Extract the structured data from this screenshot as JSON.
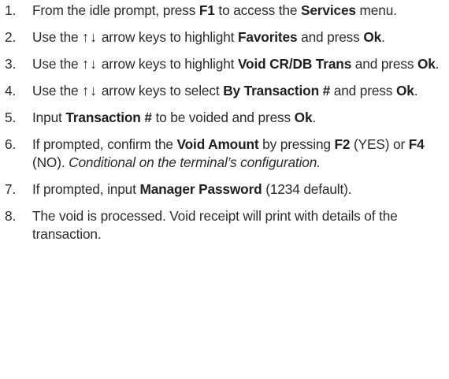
{
  "steps": [
    {
      "number": "1.",
      "segments": [
        {
          "text": "From the idle prompt, press ",
          "style": "normal"
        },
        {
          "text": "F1",
          "style": "bold"
        },
        {
          "text": " to access the ",
          "style": "normal"
        },
        {
          "text": "Services",
          "style": "bold"
        },
        {
          "text": " menu.",
          "style": "normal"
        }
      ]
    },
    {
      "number": "2.",
      "segments": [
        {
          "text": "Use the ",
          "style": "normal"
        },
        {
          "text": "↑↓",
          "style": "arrows"
        },
        {
          "text": " arrow keys to highlight ",
          "style": "normal"
        },
        {
          "text": "Favorites",
          "style": "bold"
        },
        {
          "text": " and press ",
          "style": "normal"
        },
        {
          "text": "Ok",
          "style": "bold"
        },
        {
          "text": ".",
          "style": "normal"
        }
      ]
    },
    {
      "number": "3.",
      "segments": [
        {
          "text": "Use the ",
          "style": "normal"
        },
        {
          "text": "↑↓",
          "style": "arrows"
        },
        {
          "text": " arrow keys to highlight ",
          "style": "normal"
        },
        {
          "text": "Void CR/DB Trans",
          "style": "bold"
        },
        {
          "text": " and press ",
          "style": "normal"
        },
        {
          "text": "Ok",
          "style": "bold"
        },
        {
          "text": ".",
          "style": "normal"
        }
      ]
    },
    {
      "number": "4.",
      "segments": [
        {
          "text": "Use the ",
          "style": "normal"
        },
        {
          "text": "↑↓",
          "style": "arrows"
        },
        {
          "text": " arrow keys to select ",
          "style": "normal"
        },
        {
          "text": "By Transaction #",
          "style": "bold"
        },
        {
          "text": " and press ",
          "style": "normal"
        },
        {
          "text": "Ok",
          "style": "bold"
        },
        {
          "text": ".",
          "style": "normal"
        }
      ]
    },
    {
      "number": "5.",
      "segments": [
        {
          "text": "Input ",
          "style": "normal"
        },
        {
          "text": "Transaction #",
          "style": "bold"
        },
        {
          "text": " to be voided and press ",
          "style": "normal"
        },
        {
          "text": "Ok",
          "style": "bold"
        },
        {
          "text": ".",
          "style": "normal"
        }
      ]
    },
    {
      "number": "6.",
      "segments": [
        {
          "text": "If prompted, confirm the ",
          "style": "normal"
        },
        {
          "text": "Void Amount",
          "style": "bold"
        },
        {
          "text": " by pressing ",
          "style": "normal"
        },
        {
          "text": "F2",
          "style": "bold"
        },
        {
          "text": " (YES) or ",
          "style": "normal"
        },
        {
          "text": "F4",
          "style": "bold"
        },
        {
          "text": " (NO). ",
          "style": "normal"
        },
        {
          "text": "Conditional on the terminal’s configuration.",
          "style": "italic"
        }
      ]
    },
    {
      "number": "7.",
      "segments": [
        {
          "text": "If prompted, input ",
          "style": "normal"
        },
        {
          "text": "Manager Password",
          "style": "bold"
        },
        {
          "text": " (1234 default).",
          "style": "normal"
        }
      ]
    },
    {
      "number": "8.",
      "segments": [
        {
          "text": "The void is processed. Void receipt will print with details of the transaction.",
          "style": "normal"
        }
      ]
    }
  ]
}
